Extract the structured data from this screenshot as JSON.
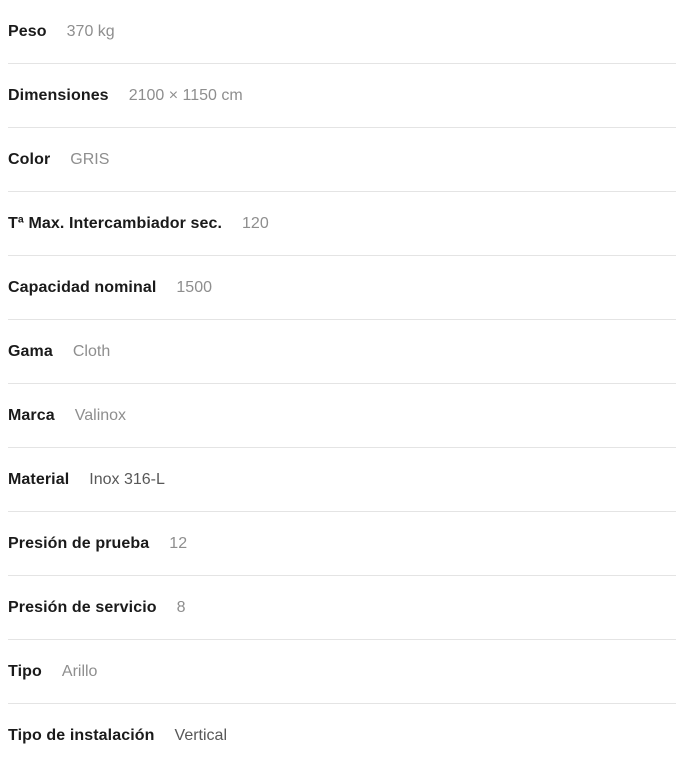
{
  "spec_sheet": {
    "rows": [
      {
        "label": "Peso",
        "value": "370 kg",
        "value_tone": "light"
      },
      {
        "label": "Dimensiones",
        "value": "2100 × 1150 cm",
        "value_tone": "light"
      },
      {
        "label": "Color",
        "value": "GRIS",
        "value_tone": "light"
      },
      {
        "label": "Tª Max. Intercambiador sec.",
        "value": "120",
        "value_tone": "light"
      },
      {
        "label": "Capacidad nominal",
        "value": "1500",
        "value_tone": "light"
      },
      {
        "label": "Gama",
        "value": "Cloth",
        "value_tone": "light"
      },
      {
        "label": "Marca",
        "value": "Valinox",
        "value_tone": "light"
      },
      {
        "label": "Material",
        "value": "Inox 316-L",
        "value_tone": "dark"
      },
      {
        "label": "Presión de prueba",
        "value": "12",
        "value_tone": "light"
      },
      {
        "label": "Presión de servicio",
        "value": "8",
        "value_tone": "light"
      },
      {
        "label": "Tipo",
        "value": "Arillo",
        "value_tone": "light"
      },
      {
        "label": "Tipo de instalación",
        "value": "Vertical",
        "value_tone": "dark"
      }
    ]
  },
  "colors": {
    "label_text": "#1a1a1a",
    "value_text_light": "#8e8e8e",
    "value_text_dark": "#585858",
    "divider": "#e4e4e4",
    "background": "#ffffff"
  }
}
